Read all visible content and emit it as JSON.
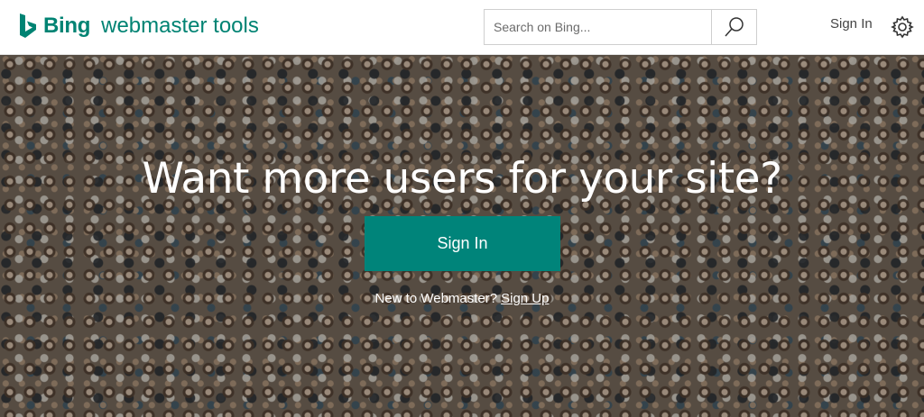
{
  "header": {
    "brand_name": "Bing",
    "product_name": "webmaster tools",
    "search_placeholder": "Search on Bing...",
    "signin_label": "Sign In",
    "icons": {
      "logo": "bing-logo-icon",
      "search": "search-icon",
      "settings": "gear-icon"
    }
  },
  "hero": {
    "title": "Want more users for your site?",
    "signin_button_label": "Sign In",
    "signup_prompt": "New to Webmaster?",
    "signup_link": "Sign Up"
  },
  "colors": {
    "accent": "#008373",
    "button": "#00847a",
    "text_on_hero": "#ffffff"
  }
}
